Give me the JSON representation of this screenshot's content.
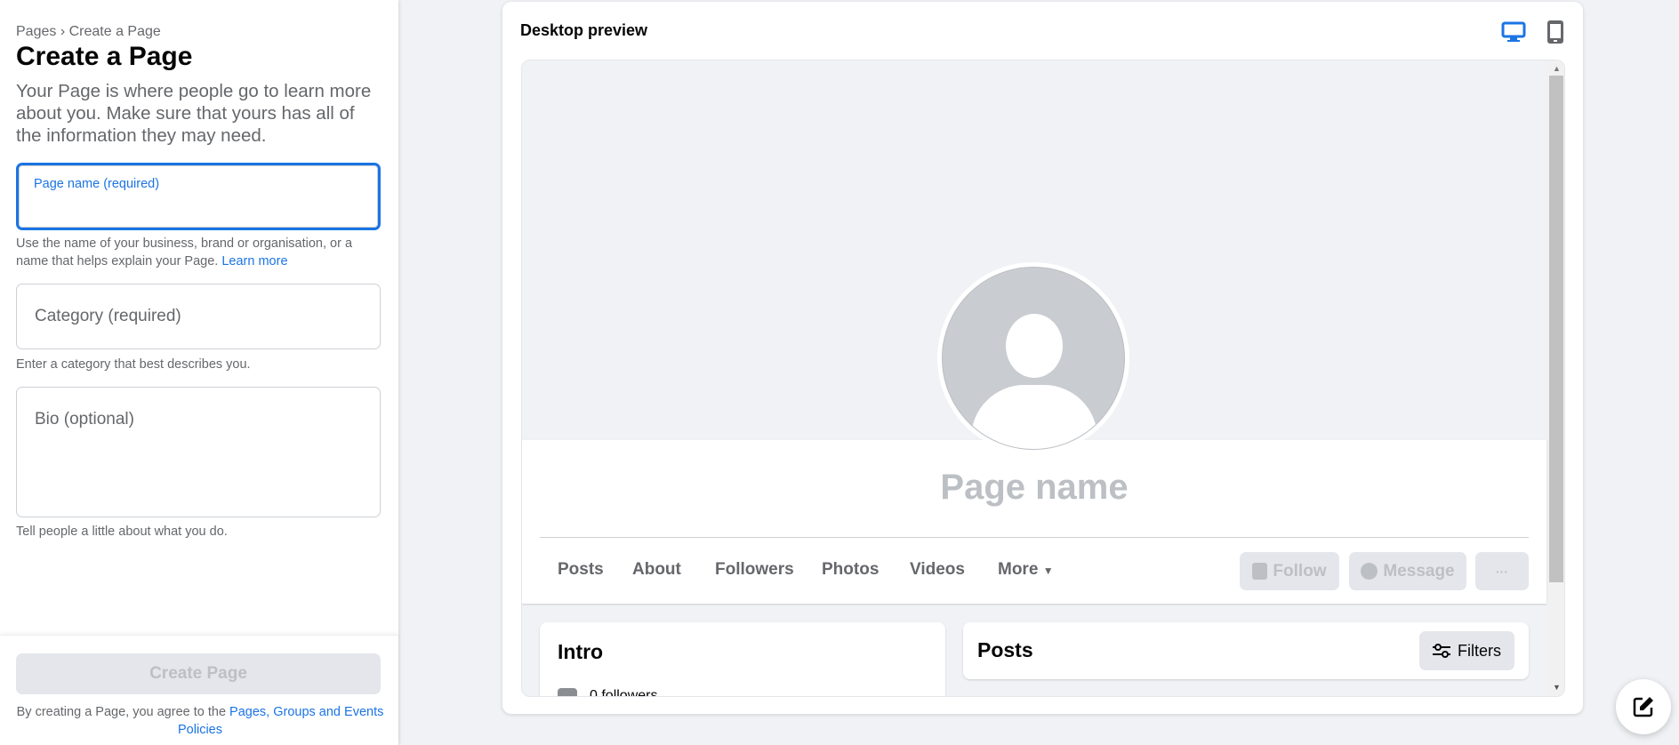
{
  "form": {
    "breadcrumb": {
      "root": "Pages",
      "separator": "›",
      "current": "Create a Page"
    },
    "title": "Create a Page",
    "description": "Your Page is where people go to learn more about you. Make sure that yours has all of the information they may need.",
    "page_name": {
      "label": "Page name (required)",
      "value": "",
      "help": "Use the name of your business, brand or organisation, or a name that helps explain your Page.",
      "help_link": "Learn more"
    },
    "category": {
      "placeholder": "Category (required)",
      "help": "Enter a category that best describes you."
    },
    "bio": {
      "placeholder": "Bio (optional)",
      "help": "Tell people a little about what you do."
    },
    "submit_label": "Create Page",
    "terms_text": "By creating a Page, you agree to the",
    "terms_link": "Pages, Groups and Events Policies"
  },
  "preview": {
    "title": "Desktop preview",
    "view_icons": [
      {
        "name": "desktop-icon",
        "active": true
      },
      {
        "name": "mobile-icon",
        "active": false
      }
    ],
    "page_name": "Page name",
    "tabs": [
      "Posts",
      "About",
      "Followers",
      "Photos",
      "Videos",
      "More"
    ],
    "buttons": {
      "follow": "Follow",
      "message": "Message",
      "more": "···"
    },
    "intro_title": "Intro",
    "intro_followers": "0 followers",
    "posts_title": "Posts",
    "filters_label": "Filters"
  },
  "colors": {
    "accent": "#1b74e4",
    "disabled_bg": "#e4e6eb",
    "disabled_text": "#bcc0c4"
  }
}
